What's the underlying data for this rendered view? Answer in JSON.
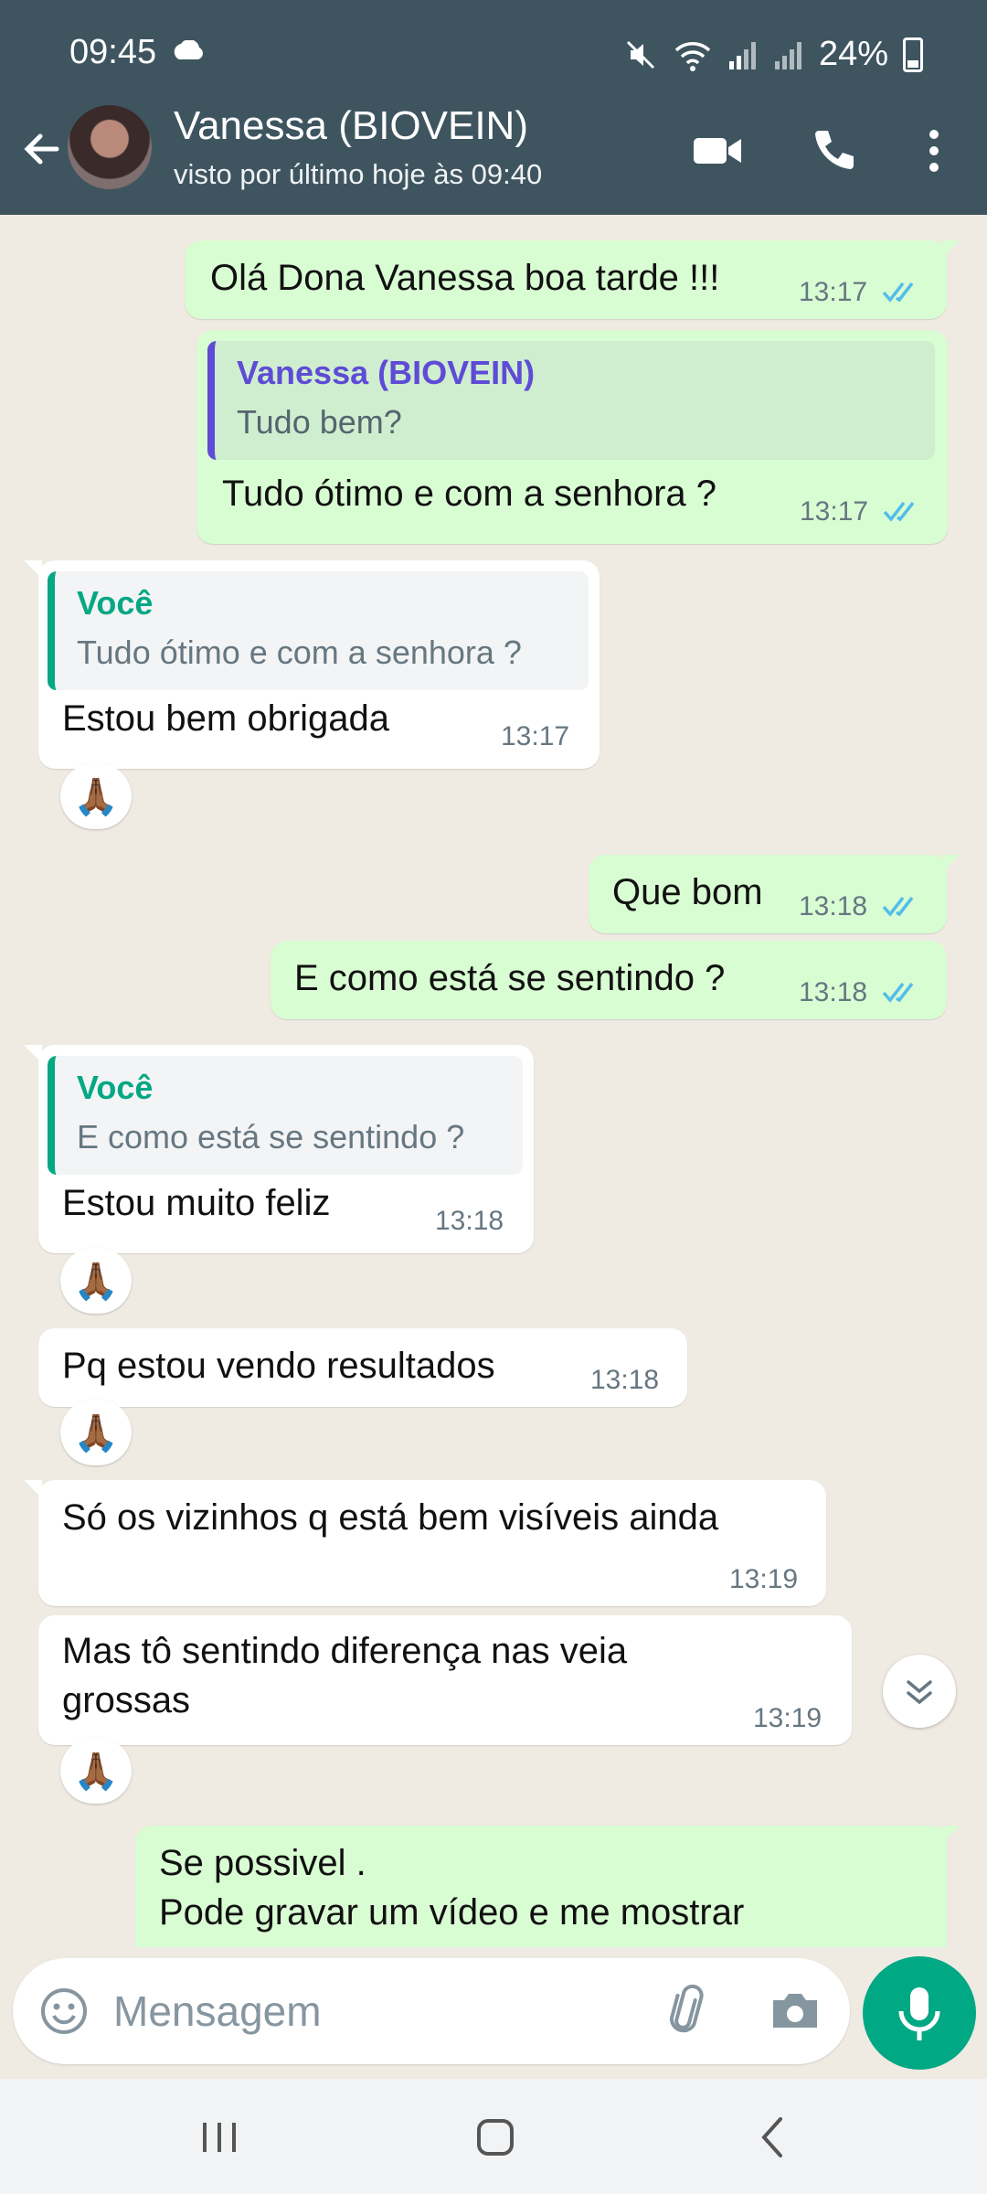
{
  "status_bar": {
    "time": "09:45",
    "battery": "24%"
  },
  "header": {
    "contact_name": "Vanessa (BIOVEIN)",
    "last_seen": "visto por último hoje às 09:40"
  },
  "messages": [
    {
      "id": "m1",
      "direction": "out",
      "text": "Olá Dona Vanessa boa tarde !!!",
      "time": "13:17"
    },
    {
      "id": "m2",
      "direction": "out",
      "quote_name": "Vanessa (BIOVEIN)",
      "quote_text": "Tudo bem?",
      "text": "Tudo ótimo e com a senhora ?",
      "time": "13:17"
    },
    {
      "id": "m3",
      "direction": "in",
      "quote_name": "Você",
      "quote_text": "Tudo ótimo e com a senhora ?",
      "text": "Estou bem obrigada",
      "time": "13:17",
      "reaction": "🙏🏾"
    },
    {
      "id": "m4",
      "direction": "out",
      "text": "Que bom",
      "time": "13:18"
    },
    {
      "id": "m5",
      "direction": "out",
      "text": "E como está se sentindo ?",
      "time": "13:18"
    },
    {
      "id": "m6",
      "direction": "in",
      "quote_name": "Você",
      "quote_text": "E como está se sentindo ?",
      "text": "Estou muito feliz",
      "time": "13:18",
      "reaction": "🙏🏾"
    },
    {
      "id": "m7",
      "direction": "in",
      "text": "Pq estou vendo resultados",
      "time": "13:18",
      "reaction": "🙏🏾"
    },
    {
      "id": "m8",
      "direction": "in",
      "text": "Só os vizinhos q está bem visíveis ainda",
      "time": "13:19"
    },
    {
      "id": "m9",
      "direction": "in",
      "text_line1": "Mas tô sentindo diferença nas veia",
      "text_line2": "grossas",
      "time": "13:19",
      "reaction": "🙏🏾"
    },
    {
      "id": "m10",
      "direction": "out",
      "text_line1": "Se possivel .",
      "text_line2": "Pode gravar um vídeo e me mostrar"
    }
  ],
  "composer": {
    "placeholder": "Mensagem"
  },
  "colors": {
    "header": "#3e5560",
    "outgoing": "#d9fdd3",
    "incoming": "#ffffff",
    "accent": "#00a884",
    "read_ticks": "#53bdeb"
  },
  "icons": [
    "back-arrow-icon",
    "video-call-icon",
    "phone-icon",
    "more-options-icon",
    "emoji-icon",
    "attach-icon",
    "camera-icon",
    "mic-icon",
    "scroll-down-icon"
  ]
}
